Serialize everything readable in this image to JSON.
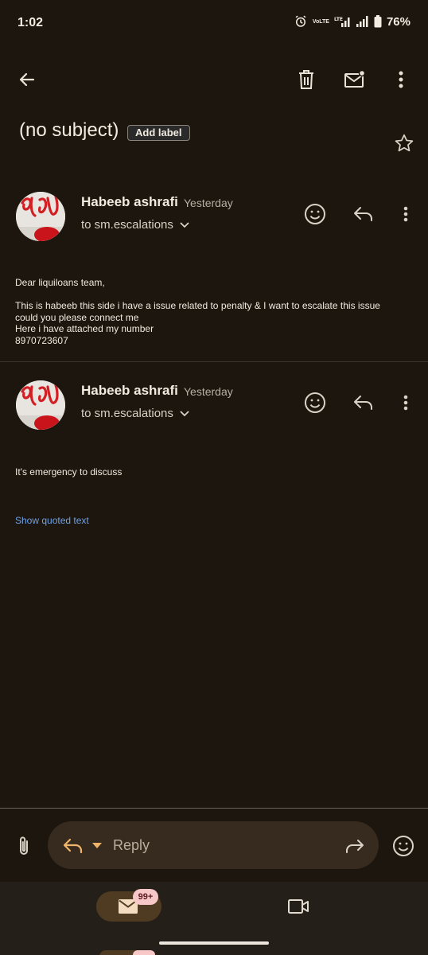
{
  "status_bar": {
    "time": "1:02",
    "network_top": "VoLTE",
    "network_bottom": "LTE",
    "battery": "76%"
  },
  "toolbar": {
    "icons": [
      "back-arrow-icon",
      "delete-icon",
      "mark-unread-icon",
      "more-vert-icon"
    ]
  },
  "subject": {
    "title": "(no subject)",
    "label_chip": "Add label"
  },
  "messages": [
    {
      "sender": "Habeeb ashrafi",
      "date": "Yesterday",
      "to": "to sm.escalations",
      "body": [
        "Dear liquiloans team,",
        "",
        "This is habeeb this side i have a issue related to penalty & I want to escalate this issue",
        "could you please connect me",
        "Here i have attached my number",
        "8970723607"
      ]
    },
    {
      "sender": "Habeeb ashrafi",
      "date": "Yesterday",
      "to": "to sm.escalations",
      "body": [
        "It's emergency to discuss"
      ],
      "show_quoted": "Show quoted text"
    }
  ],
  "reply_bar": {
    "placeholder": "Reply"
  },
  "bottom_nav": {
    "mail_badge": "99+"
  },
  "colors": {
    "background": "#1c160e",
    "accent_link": "#6ea0e6",
    "reply_arrow": "#f0b46a",
    "badge": "#f8c7c8"
  }
}
